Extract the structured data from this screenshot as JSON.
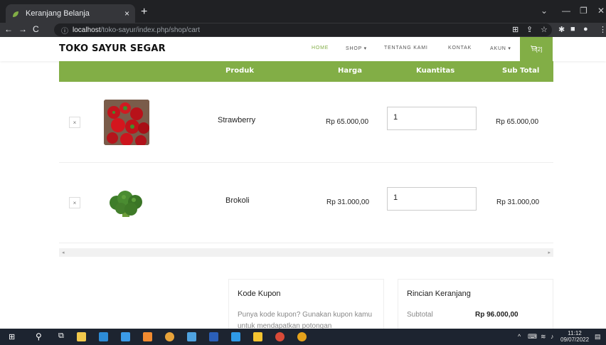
{
  "browser": {
    "tab_title": "Keranjang Belanja",
    "tab_close": "×",
    "new_tab": "+",
    "url_host": "localhost",
    "url_path": "/toko-sayur/index.php/shop/cart",
    "win_minimize": "—",
    "win_restore": "❐",
    "win_close": "✕",
    "win_dropdown": "⌄"
  },
  "site": {
    "brand": "TOKO SAYUR SEGAR",
    "menu": [
      "HOME",
      "SHOP ▾",
      "TENTANG KAMI",
      "KONTAK",
      "AKUN ▾"
    ],
    "cart_label": "[2]",
    "accent": "#82ae46"
  },
  "cart": {
    "headers": [
      "Produk",
      "Harga",
      "Kuantitas",
      "Sub Total"
    ],
    "rows": [
      {
        "remove": "×",
        "name": "Strawberry",
        "price": "Rp 65.000,00",
        "qty": "1",
        "subtotal": "Rp 65.000,00"
      },
      {
        "remove": "×",
        "name": "Brokoli",
        "price": "Rp 31.000,00",
        "qty": "1",
        "subtotal": "Rp 31.000,00"
      }
    ]
  },
  "coupon": {
    "title": "Kode Kupon",
    "text": "Punya kode kupon? Gunakan kupon kamu untuk mendapatkan potongan"
  },
  "summary": {
    "title": "Rincian Keranjang",
    "subtotal_label": "Subtotal",
    "subtotal_value": "Rp 96.000,00"
  },
  "taskbar": {
    "time": "11:12",
    "date": "09/07/2022"
  }
}
